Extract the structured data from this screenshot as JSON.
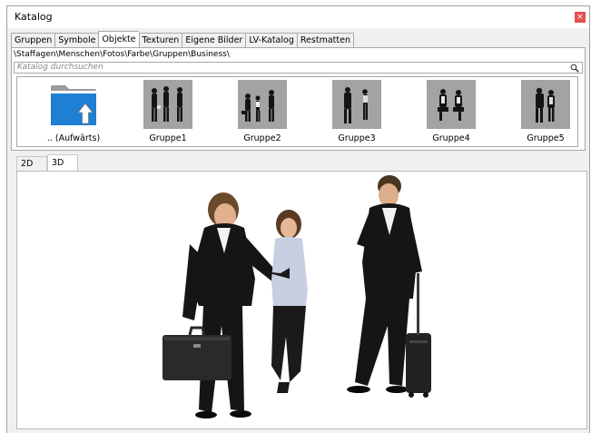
{
  "window": {
    "title": "Katalog",
    "close_symbol": "×"
  },
  "tabs": [
    {
      "label": "Gruppen",
      "active": false
    },
    {
      "label": "Symbole",
      "active": false
    },
    {
      "label": "Objekte",
      "active": true
    },
    {
      "label": "Texturen",
      "active": false
    },
    {
      "label": "Eigene Bilder",
      "active": false
    },
    {
      "label": "LV-Katalog",
      "active": false
    },
    {
      "label": "Restmatten",
      "active": false
    }
  ],
  "path": "\\Staffagen\\Menschen\\Fotos\\Farbe\\Gruppen\\Business\\",
  "search": {
    "placeholder": "Katalog durchsuchen",
    "icon": "magnifier-icon"
  },
  "items": [
    {
      "label": ".. (Aufwärts)",
      "icon": "folder-up-icon"
    },
    {
      "label": "Gruppe1"
    },
    {
      "label": "Gruppe2"
    },
    {
      "label": "Gruppe3"
    },
    {
      "label": "Gruppe4"
    },
    {
      "label": "Gruppe5"
    }
  ],
  "view_tabs": [
    {
      "label": "2D",
      "active": false
    },
    {
      "label": "3D",
      "active": true
    }
  ],
  "colors": {
    "close": "#e55050",
    "folder": "#1e7fd4",
    "thumb_bg": "#a3a3a3",
    "suit": "#141414"
  }
}
